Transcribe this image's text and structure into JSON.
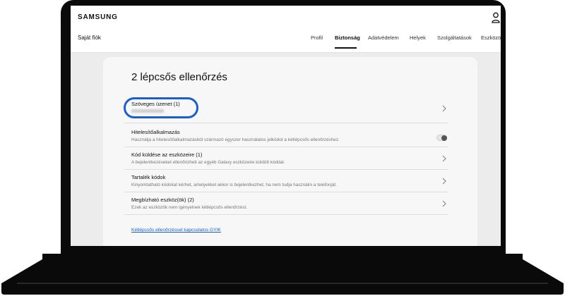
{
  "header": {
    "logo": "SAMSUNG",
    "account_label": "Saját fiók",
    "nav": [
      "Profil",
      "Biztonság",
      "Adatvédelem",
      "Helyek",
      "Szolgáltatások",
      "Eszközök"
    ],
    "active_nav": "Biztonság"
  },
  "card": {
    "title": "2 lépcsős ellenőrzés",
    "items": [
      {
        "title": "Szöveges üzenet (1)",
        "description": "",
        "control": "chevron",
        "highlighted": true
      },
      {
        "title": "Hitelesítőalkalmazás",
        "description": "Használja a hitelesítőalkalmazásból származó egyszer használatos jelkódot a kétlépcsős ellenőrzéshez.",
        "control": "toggle",
        "toggle_on": false
      },
      {
        "title": "Kód küldése az eszközeire (1)",
        "description": "A bejelentkezéseket ellenőrizheti az egyéb Galaxy eszközeire küldött kóddal.",
        "control": "chevron"
      },
      {
        "title": "Tartalék kódok",
        "description": "Kinyomtatható kódokat kérhet, amelyekkel akkor is bejelentkezhet, ha nem tudja használni a telefonját.",
        "control": "chevron"
      },
      {
        "title": "Megbízható eszköz(ök) (2)",
        "description": "Ezek az eszközök nem igényelnek kétlépcsős ellenőrzést.",
        "control": "chevron"
      }
    ],
    "faq_link": "Kétlépcsős ellenőrzéssel kapcsolatos GYIK"
  },
  "colors": {
    "accent": "#1a5fd0",
    "frame": "#0a0a0a",
    "page_bg": "#ececec",
    "card_bg": "#f7f7f7"
  },
  "icons": {
    "user": "user-icon",
    "chevron": "chevron-right-icon"
  }
}
